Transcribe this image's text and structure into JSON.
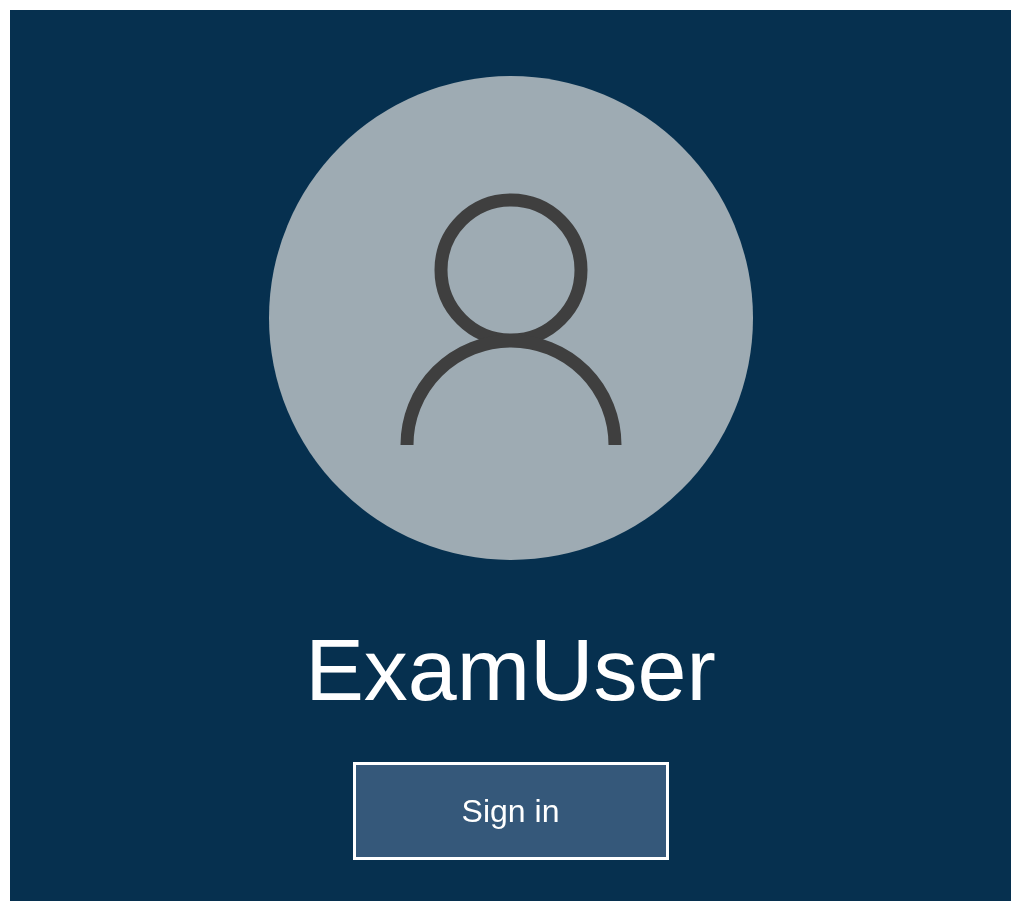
{
  "user": {
    "name": "ExamUser"
  },
  "buttons": [
    {
      "label": "Sign in"
    }
  ]
}
